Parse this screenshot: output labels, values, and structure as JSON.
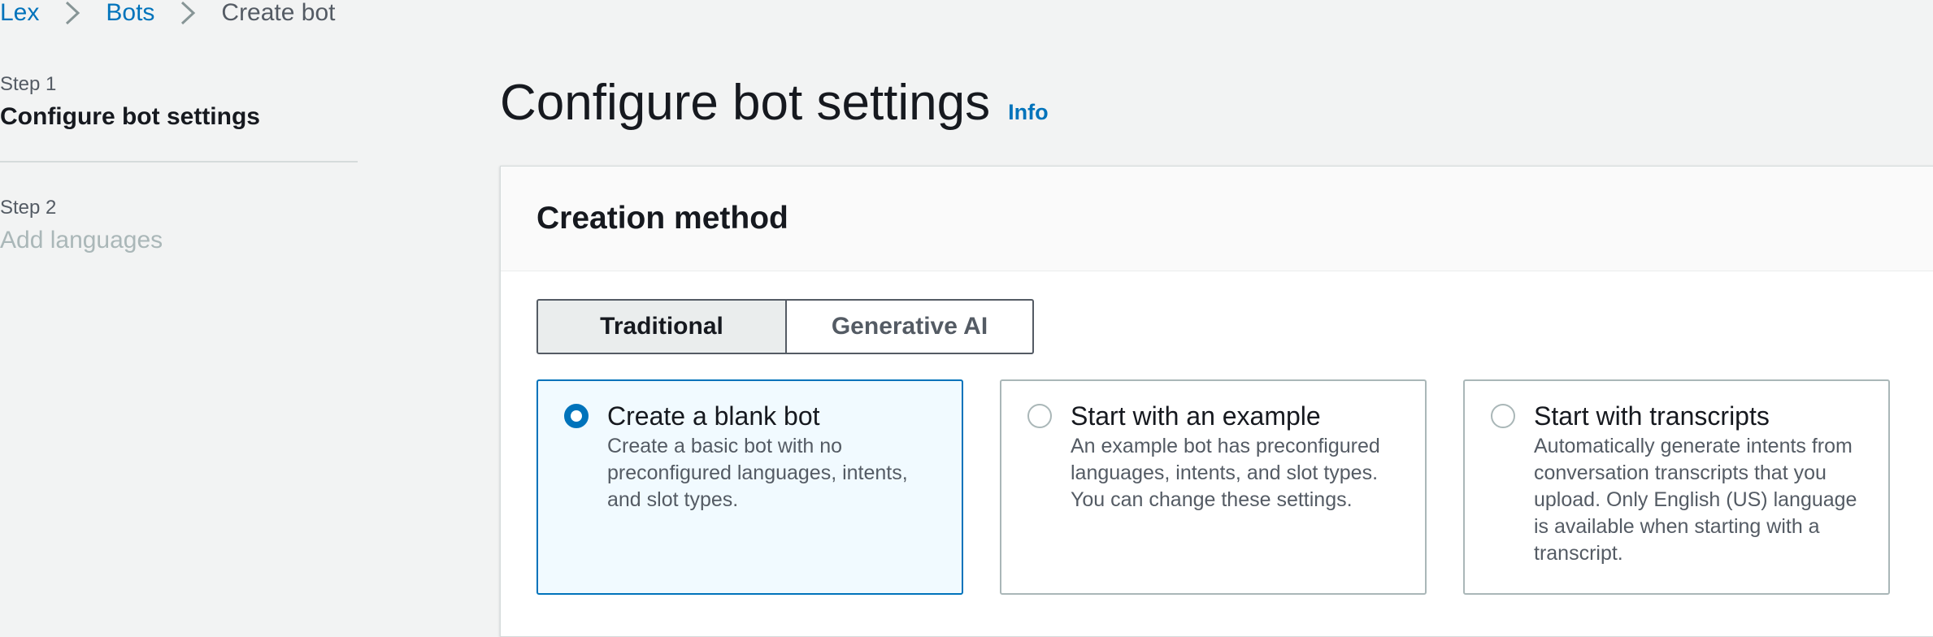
{
  "breadcrumb": {
    "items": [
      {
        "label": "Lex"
      },
      {
        "label": "Bots"
      },
      {
        "label": "Create bot"
      }
    ]
  },
  "steps": [
    {
      "step_label": "Step 1",
      "title": "Configure bot settings",
      "active": true
    },
    {
      "step_label": "Step 2",
      "title": "Add languages",
      "active": false
    }
  ],
  "header": {
    "title": "Configure bot settings",
    "info_label": "Info"
  },
  "creation": {
    "title": "Creation method",
    "segments": [
      {
        "label": "Traditional",
        "selected": true
      },
      {
        "label": "Generative AI",
        "selected": false
      }
    ],
    "tiles": [
      {
        "title": "Create a blank bot",
        "description": "Create a basic bot with no preconfigured languages, intents, and slot types.",
        "selected": true
      },
      {
        "title": "Start with an example",
        "description": "An example bot has preconfigured languages, intents, and slot types. You can change these settings.",
        "selected": false
      },
      {
        "title": "Start with transcripts",
        "description": "Automatically generate intents from conversation transcripts that you upload. Only English (US) language is available when starting with a transcript.",
        "selected": false
      }
    ]
  },
  "colors": {
    "page_background": "#f2f3f3",
    "link": "#0073bb",
    "text_primary": "#16191f",
    "text_secondary": "#545b64",
    "text_disabled": "#aab7b8",
    "selected_tile_background": "#f1faff"
  }
}
